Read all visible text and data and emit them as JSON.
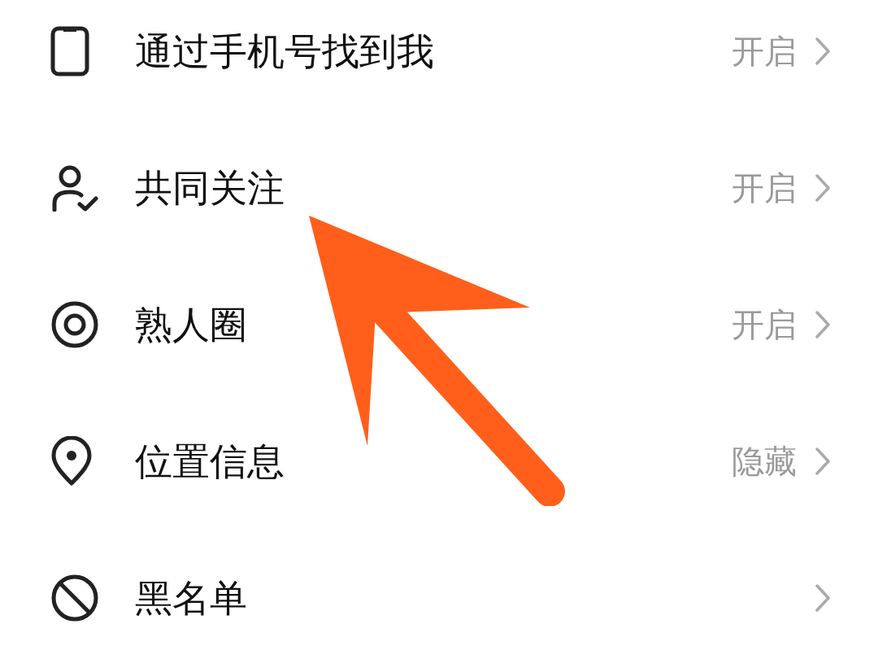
{
  "settings": [
    {
      "kind": "phone",
      "label": "通过手机号找到我",
      "value": "开启"
    },
    {
      "kind": "person",
      "label": "共同关注",
      "value": "开启"
    },
    {
      "kind": "ring",
      "label": "熟人圈",
      "value": "开启"
    },
    {
      "kind": "pin",
      "label": "位置信息",
      "value": "隐藏"
    },
    {
      "kind": "ban",
      "label": "黑名单"
    }
  ]
}
